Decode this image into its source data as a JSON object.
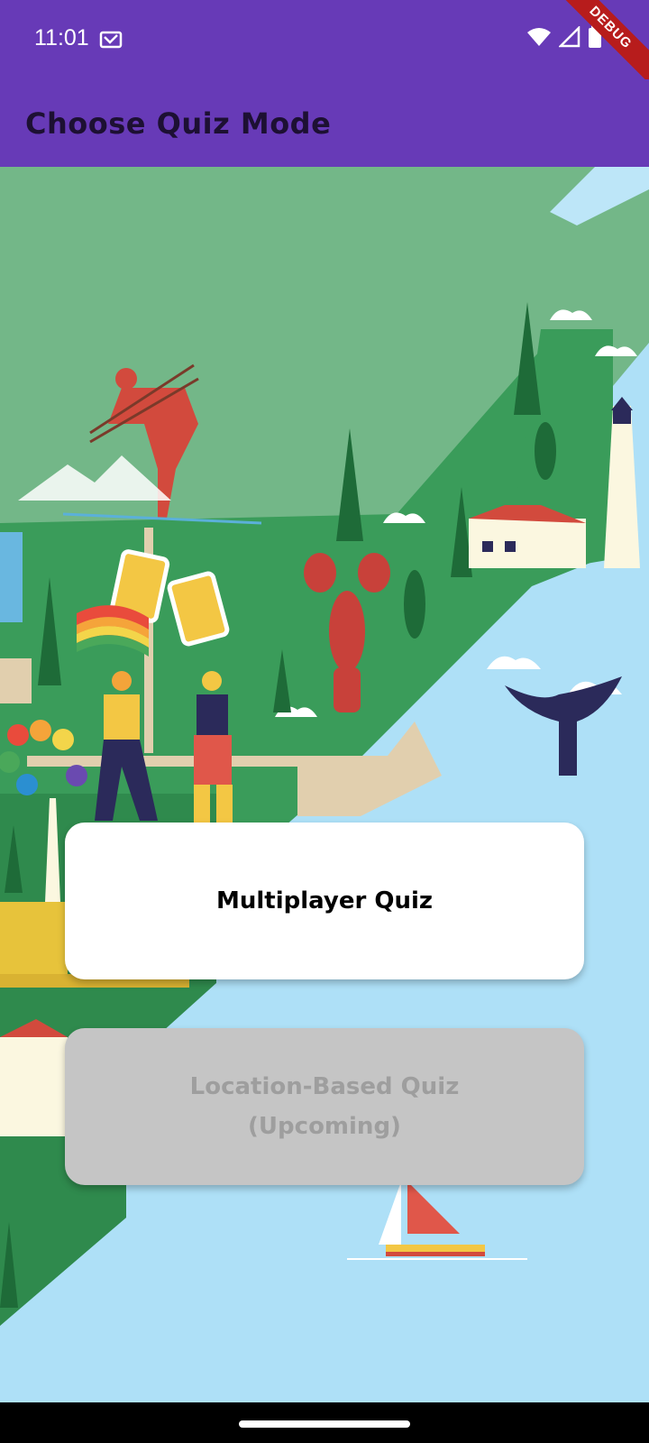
{
  "status_bar": {
    "time": "11:01",
    "debug_label": "DEBUG",
    "icons": [
      "notification-icon",
      "wifi-icon",
      "signal-icon",
      "battery-icon"
    ]
  },
  "app_bar": {
    "title": "Choose Quiz Mode"
  },
  "colors": {
    "primary": "#673ab7",
    "title_text": "#1d1033",
    "card": "#ffffff",
    "card_disabled": "#c5c5c5",
    "water": "#aee0f7",
    "land": "#3a9c5a"
  },
  "buttons": {
    "multiplayer": "Multiplayer Quiz",
    "location_line1": "Location-Based Quiz",
    "location_line2": "(Upcoming)"
  }
}
